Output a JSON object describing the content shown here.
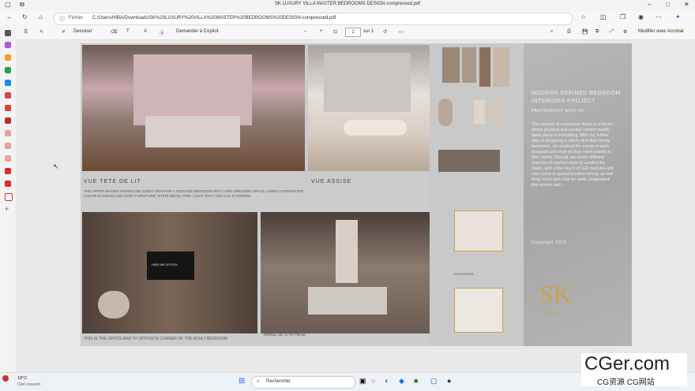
{
  "browser": {
    "title": "SK LUXURY VILLA MASTER BEDROOMS DESIGN-compressed.pdf",
    "address_label": "Fichier",
    "url": "C:/Users/HIBA/Downloads/SK%20LUXURY%20VILLA%20MASTER%20BEDROOMS%20DESIGN-compressed.pdf"
  },
  "pdf_toolbar": {
    "draw": "Dessiner",
    "copilot": "Demander à Copilot",
    "page": "1",
    "of": "sur 1",
    "edit": "Modifier avec Acrobat"
  },
  "doc": {
    "heading1": "MODERN REFINED BEDROOM",
    "heading2": "INTERIORS PROJECT",
    "sub": "PARTNERSHIP WITH SK",
    "body": "The concept of a luxurious home is a house where physical and mental comfort mostly takes place in everything. With our further step of designing a client's first floor family bedrooms, we analized the needs of each occupant and what do they need exactly in their rooms. Overall, we chose different nuances of neutral colors to comfort the vision, with a fine touch of LED modules and vital colors to spread positive energy as well thing wood dark Oak for walls, longitudinal thin mirrors and ...",
    "copyright": "Copyright 2023",
    "logo_text": "SK",
    "logo_sub": "LUXURY",
    "caption1": "VUE TETE DE LIT",
    "caption2": "VUE ASSISE",
    "desc": "THE UPPER IMAGES SHOWCASE GUEST SIGN FOR A TEENAGE BEDROOM WITH A BIG DRESSING SPACE, USING CONTRASTED COLOR NUANCES AND COSY FURNITURE: WHITE BEIGE, PINK, LIGHT GRAY AND OAK FLOORING.",
    "caption3": "THIS IS THE OFFICE AND TV OPPOSITE CORNER OF THE ADULT BEDROOM",
    "caption4": "IMAGE DE SYNTHESE",
    "tv_logo": "HIBA MB DESIGN",
    "elevations": "ELEVATIONS"
  },
  "taskbar": {
    "weather_temp": "18°C",
    "weather_desc": "Ciel couvert",
    "search_placeholder": "Rechercher"
  },
  "watermark": {
    "big": "CGer.com",
    "small": "CG资源 CG网站"
  },
  "colors": {
    "accent_gold": "#c8a24a",
    "pink": "#d8aeb4",
    "dark_wood": "#5a4a3f"
  }
}
